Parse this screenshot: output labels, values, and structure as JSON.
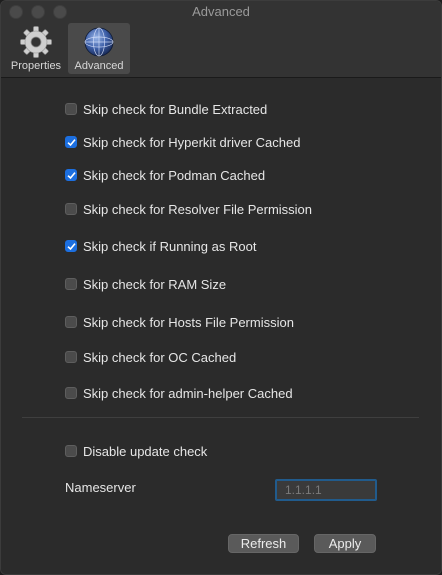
{
  "window": {
    "title": "Advanced"
  },
  "tabs": [
    {
      "label": "Properties",
      "icon": "gear-icon",
      "selected": false
    },
    {
      "label": "Advanced",
      "icon": "globe-icon",
      "selected": true
    }
  ],
  "checks": [
    {
      "label": "Skip check for Bundle Extracted",
      "checked": false
    },
    {
      "label": "Skip check for Hyperkit driver Cached",
      "checked": true
    },
    {
      "label": "Skip check for Podman Cached",
      "checked": true
    },
    {
      "label": "Skip check for Resolver File Permission",
      "checked": false
    },
    {
      "label": "Skip check if Running as Root",
      "checked": true
    },
    {
      "label": "Skip check for RAM Size",
      "checked": false
    },
    {
      "label": "Skip check for Hosts File Permission",
      "checked": false
    },
    {
      "label": "Skip check for OC Cached",
      "checked": false
    },
    {
      "label": "Skip check for admin-helper Cached",
      "checked": false
    }
  ],
  "update": {
    "label": "Disable update check",
    "checked": false
  },
  "nameserver": {
    "label": "Nameserver",
    "value": "",
    "placeholder": "1.1.1.1"
  },
  "buttons": {
    "refresh": "Refresh",
    "apply": "Apply"
  },
  "colors": {
    "accent": "#1c6fe0",
    "focus_ring": "#215b8c"
  }
}
